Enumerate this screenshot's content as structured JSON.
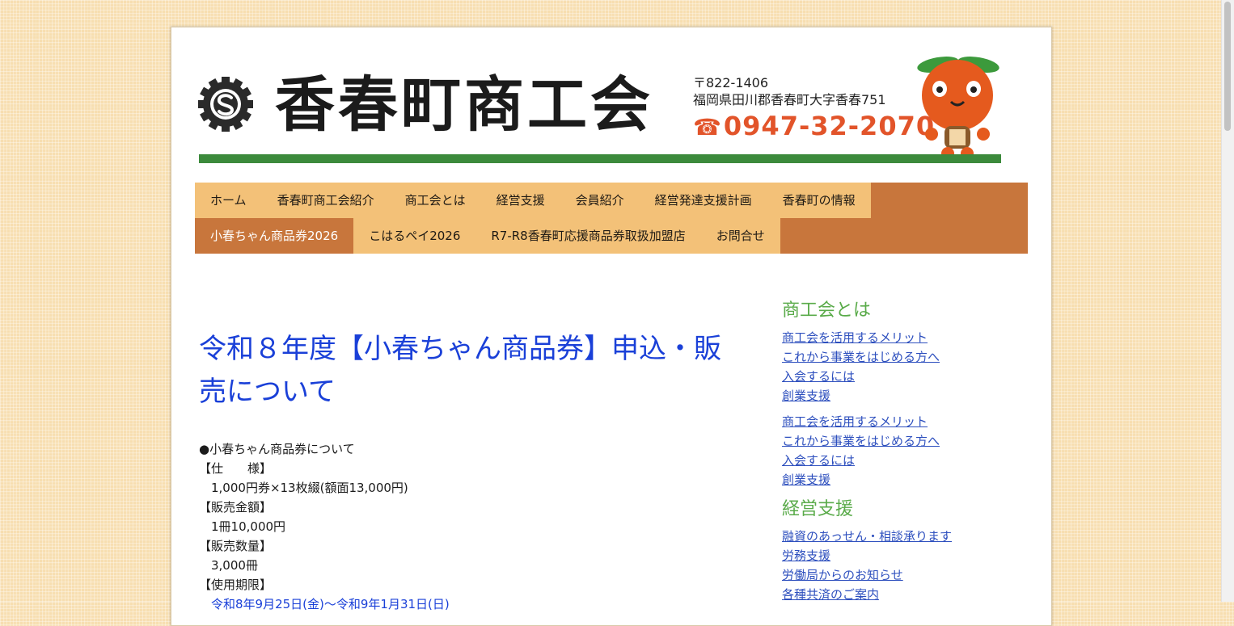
{
  "header": {
    "site_title": "香春町商工会",
    "postal": "〒822-1406",
    "address": "福岡県田川郡香春町大字香春751",
    "phone_icon": "☎",
    "phone": "0947-32-2070"
  },
  "nav": {
    "row1": [
      "ホーム",
      "香春町商工会紹介",
      "商工会とは",
      "経営支援",
      "会員紹介",
      "経営発達支援計画",
      "香春町の情報"
    ],
    "row2": [
      "小春ちゃん商品券2026",
      "こはるペイ2026",
      "R7-R8香春町応援商品券取扱加盟店",
      "お問合せ"
    ]
  },
  "main": {
    "title": "令和８年度【小春ちゃん商品券】申込・販売について",
    "lines": [
      "●小春ちゃん商品券について",
      "【仕　　様】",
      "　1,000円券×13枚綴(額面13,000円)",
      "【販売金額】",
      "　1冊10,000円",
      "【販売数量】",
      "　3,000冊",
      "【使用期限】",
      "　令和8年9月25日(金)～令和9年1月31日(日)"
    ]
  },
  "sidebar": {
    "section1_title": "商工会とは",
    "group1": [
      "商工会を活用するメリット",
      "これから事業をはじめる方へ",
      "入会するには",
      "創業支援"
    ],
    "group2": [
      "商工会を活用するメリット",
      "これから事業をはじめる方へ",
      "入会するには",
      "創業支援"
    ],
    "section2_title": "経営支援",
    "group3": [
      "融資のあっせん・相談承ります",
      "労務支援",
      "労働局からのお知らせ",
      "各種共済のご案内"
    ]
  },
  "colors": {
    "accent": "#c8763c",
    "nav_bg": "#f3c178",
    "title_blue": "#1a40d8",
    "green": "#3c8a3c"
  }
}
